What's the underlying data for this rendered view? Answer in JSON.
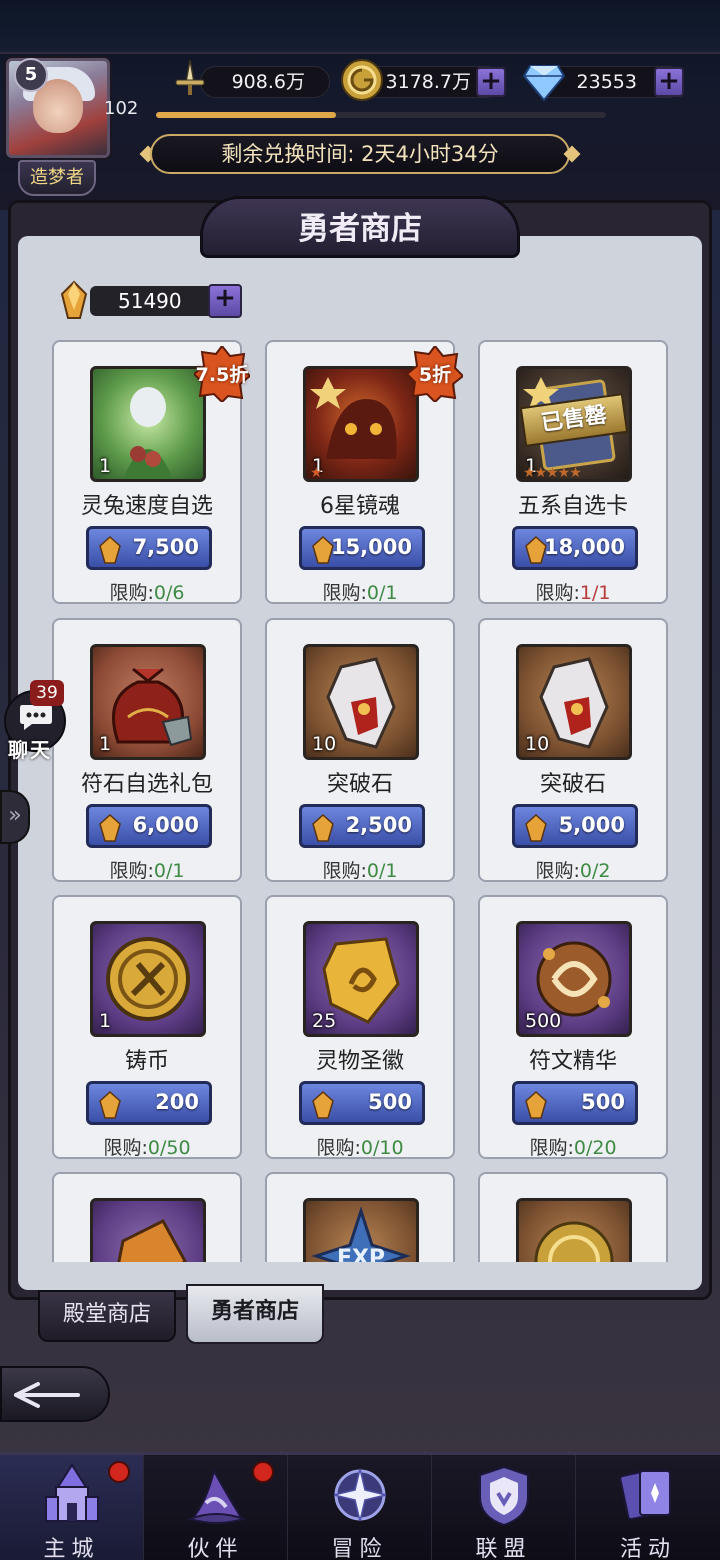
{
  "header": {
    "level": "5",
    "level_number": "102",
    "player_title": "造梦者",
    "power": "908.6万",
    "gold": "3178.7万",
    "diamonds": "23553",
    "exp_progress": 0.4,
    "timer_label": "剩余兑换时间: 2天4小时34分"
  },
  "shop": {
    "title": "勇者商店",
    "currency_amount": "51490",
    "items": [
      {
        "name": "灵兔速度自选",
        "qty": "1",
        "price": "7,500",
        "limit_label": "限购:",
        "limit": "0/6",
        "discount": "7.5折"
      },
      {
        "name": "6星镜魂",
        "qty": "1",
        "price": "15,000",
        "limit_label": "限购:",
        "limit": "0/1",
        "discount": "5折"
      },
      {
        "name": "五系自选卡",
        "qty": "1",
        "price": "18,000",
        "limit_label": "限购:",
        "limit": "1/1",
        "sold_out": "已售罄"
      },
      {
        "name": "符石自选礼包",
        "qty": "1",
        "price": "6,000",
        "limit_label": "限购:",
        "limit": "0/1"
      },
      {
        "name": "突破石",
        "qty": "10",
        "price": "2,500",
        "limit_label": "限购:",
        "limit": "0/1"
      },
      {
        "name": "突破石",
        "qty": "10",
        "price": "5,000",
        "limit_label": "限购:",
        "limit": "0/2"
      },
      {
        "name": "铸币",
        "qty": "1",
        "price": "200",
        "limit_label": "限购:",
        "limit": "0/50"
      },
      {
        "name": "灵物圣徽",
        "qty": "25",
        "price": "500",
        "limit_label": "限购:",
        "limit": "0/10"
      },
      {
        "name": "符文精华",
        "qty": "500",
        "price": "500",
        "limit_label": "限购:",
        "limit": "0/20"
      },
      {
        "name": "",
        "qty": "",
        "price": "",
        "limit_label": "",
        "limit": ""
      },
      {
        "name": "",
        "qty": "",
        "price": "",
        "limit_label": "",
        "limit": "",
        "art_text": "EXP"
      },
      {
        "name": "",
        "qty": "",
        "price": "",
        "limit_label": "",
        "limit": ""
      }
    ]
  },
  "tabs": {
    "hall_shop": "殿堂商店",
    "hero_shop": "勇者商店"
  },
  "chat": {
    "badge": "39",
    "label": "聊天"
  },
  "nav": {
    "main_city": "主城",
    "partner": "伙伴",
    "adventure": "冒险",
    "alliance": "联盟",
    "activity": "活动"
  },
  "icons": {
    "power": "sword-icon",
    "gold": "gold-coin-icon",
    "diamond": "diamond-icon",
    "shop_currency": "amber-crystal-icon"
  },
  "colors": {
    "limit_ok": "#3e8a43",
    "limit_full": "#b93a3a",
    "price_button": "#4b62c0",
    "badge_red": "#d3261c"
  }
}
